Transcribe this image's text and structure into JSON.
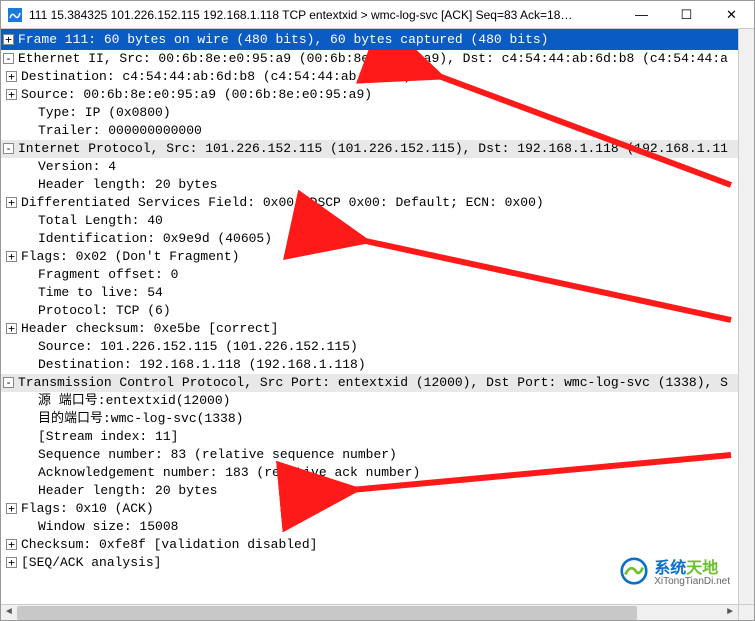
{
  "window": {
    "title": "111 15.384325 101.226.152.115 192.168.1.118 TCP entextxid > wmc-log-svc [ACK] Seq=83 Ack=18…"
  },
  "frame_summary": "Frame 111: 60 bytes on wire (480 bits), 60 bytes captured (480 bits)",
  "ethernet": {
    "header": "Ethernet II, Src: 00:6b:8e:e0:95:a9 (00:6b:8e:e0:95:a9), Dst: c4:54:44:ab:6d:b8 (c4:54:44:a",
    "destination": "Destination: c4:54:44:ab:6d:b8 (c4:54:44:ab:6d:b8)",
    "source": "Source: 00:6b:8e:e0:95:a9 (00:6b:8e:e0:95:a9)",
    "type": "Type: IP (0x0800)",
    "trailer": "Trailer: 000000000000"
  },
  "ip": {
    "header": "Internet Protocol, Src: 101.226.152.115 (101.226.152.115), Dst: 192.168.1.118 (192.168.1.11",
    "version": "Version: 4",
    "hlen": "Header length: 20 bytes",
    "dsf": "Differentiated Services Field: 0x00 (DSCP 0x00: Default; ECN: 0x00)",
    "tlen": "Total Length: 40",
    "id": "Identification: 0x9e9d (40605)",
    "flags": "Flags: 0x02 (Don't Fragment)",
    "frag": "Fragment offset: 0",
    "ttl": "Time to live: 54",
    "proto": "Protocol: TCP (6)",
    "cksum": "Header checksum: 0xe5be [correct]",
    "src": "Source: 101.226.152.115 (101.226.152.115)",
    "dst": "Destination: 192.168.1.118 (192.168.1.118)"
  },
  "tcp": {
    "header": "Transmission Control Protocol, Src Port: entextxid (12000), Dst Port: wmc-log-svc (1338), S",
    "srcport": "源  端口号:entextxid(12000)",
    "dstport": "目的端口号:wmc-log-svc(1338)",
    "stream": "[Stream index: 11]",
    "seq": "Sequence number: 83    (relative sequence number)",
    "ack": "Acknowledgement number: 183    (relative ack number)",
    "hlen": "Header length: 20 bytes",
    "flags": "Flags: 0x10 (ACK)",
    "win": "Window size: 15008",
    "cksum": "Checksum: 0xfe8f [validation disabled]",
    "seqack": "[SEQ/ACK analysis]"
  },
  "watermark": {
    "brand_cn1": "系统",
    "brand_cn2": "天地",
    "url": "XiTongTianDi.net"
  }
}
